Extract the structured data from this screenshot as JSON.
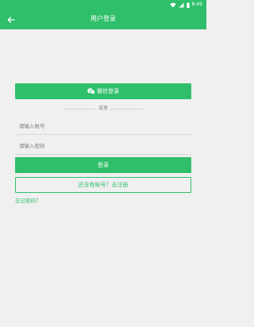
{
  "status_bar": {
    "time": "8:49",
    "icons": [
      "wifi-icon",
      "signal-icon",
      "battery-icon"
    ]
  },
  "app_bar": {
    "title": "用户登录",
    "back_icon": "arrow-left-icon"
  },
  "wechat_login": {
    "label": "微信登录",
    "icon": "wechat-icon"
  },
  "divider": {
    "text": "或者"
  },
  "account_field": {
    "placeholder": "请输入账号",
    "value": ""
  },
  "password_field": {
    "placeholder": "请输入密码",
    "value": ""
  },
  "login_button": {
    "label": "登录"
  },
  "register_button": {
    "label": "还没有帐号？去注册"
  },
  "forgot_password": {
    "label": "忘记密码？"
  },
  "colors": {
    "primary": "#2fbf6b",
    "background": "#f0f0f0",
    "divider": "#d4d4d4"
  }
}
